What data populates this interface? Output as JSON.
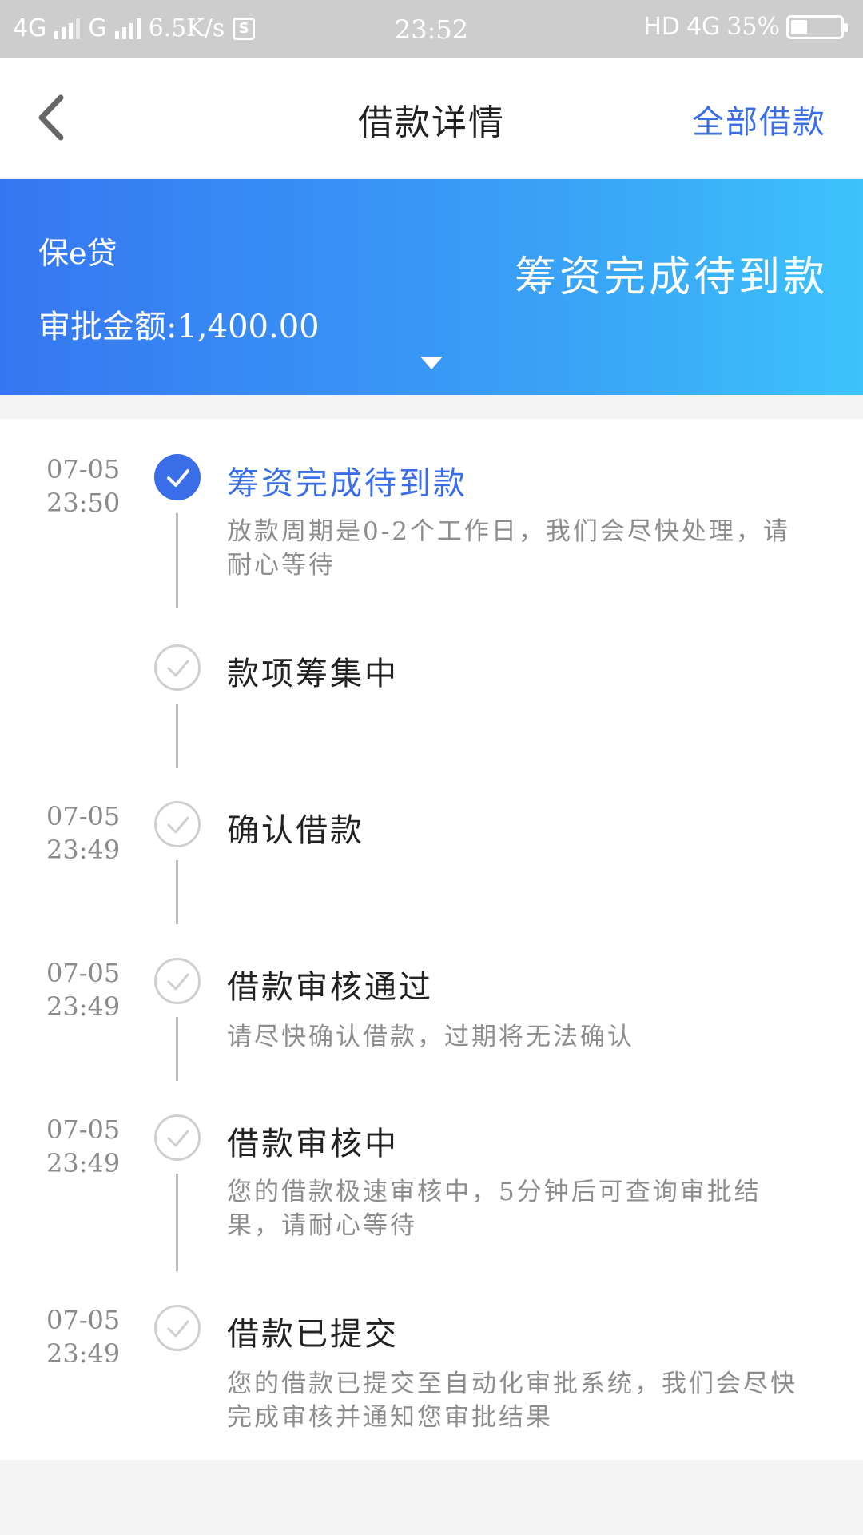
{
  "status_bar": {
    "network1": "4G",
    "network2": "G",
    "speed": "6.5K/s",
    "sim_icon": "S",
    "time": "23:52",
    "hd": "HD",
    "network3": "4G",
    "battery": "35%"
  },
  "header": {
    "title": "借款详情",
    "right_link": "全部借款"
  },
  "banner": {
    "product": "保e贷",
    "amount_label": "审批金额:",
    "amount_value": "1,400.00",
    "status": "筹资完成待到款"
  },
  "timeline": [
    {
      "date": "07-05",
      "time": "23:50",
      "title": "筹资完成待到款",
      "desc": "放款周期是0-2个工作日，我们会尽快处理，请耐心等待",
      "active": true
    },
    {
      "date": "",
      "time": "",
      "title": "款项筹集中",
      "desc": "",
      "active": false
    },
    {
      "date": "07-05",
      "time": "23:49",
      "title": "确认借款",
      "desc": "",
      "active": false
    },
    {
      "date": "07-05",
      "time": "23:49",
      "title": "借款审核通过",
      "desc": "请尽快确认借款，过期将无法确认",
      "active": false
    },
    {
      "date": "07-05",
      "time": "23:49",
      "title": "借款审核中",
      "desc": "您的借款极速审核中，5分钟后可查询审批结果，请耐心等待",
      "active": false
    },
    {
      "date": "07-05",
      "time": "23:49",
      "title": "借款已提交",
      "desc": "您的借款已提交至自动化审批系统，我们会尽快完成审核并通知您审批结果",
      "active": false
    }
  ],
  "colors": {
    "accent": "#3a6ee8",
    "banner_start": "#3676f2",
    "banner_end": "#3cc3fb"
  }
}
